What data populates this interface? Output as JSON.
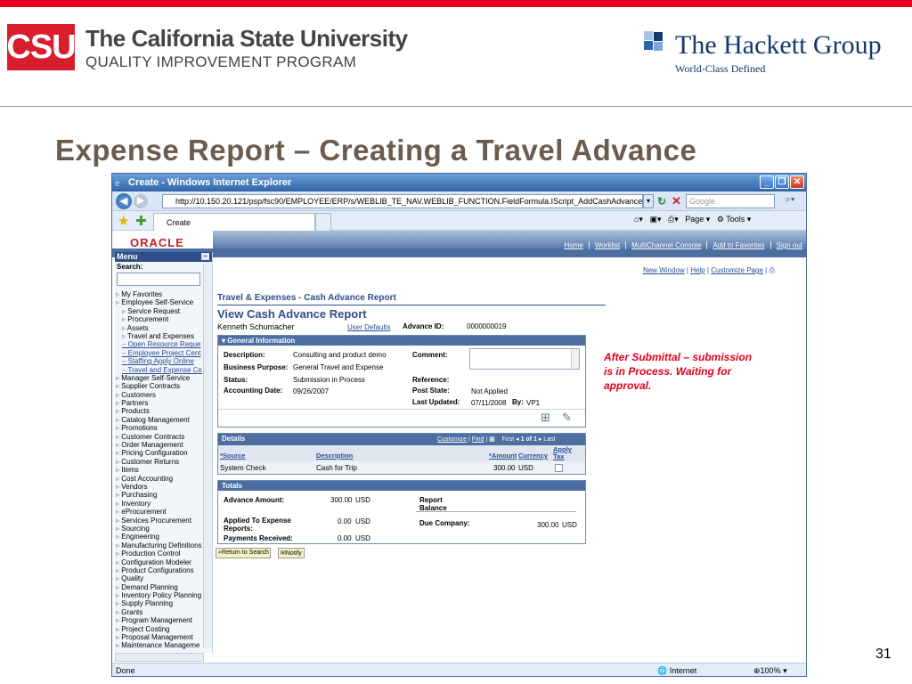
{
  "slide": {
    "csu_logo": "CSU",
    "csu_name": "The California State University",
    "csu_subtitle": "QUALITY IMPROVEMENT PROGRAM",
    "hackett_name": "The Hackett Group",
    "hackett_tagline": "World-Class Defined",
    "title": "Expense Report – Creating a Travel Advance",
    "page_number": "31",
    "annotation": "After Submittal – submission is in Process.  Waiting for approval.",
    "colors": {
      "accent_red": "#e8001c",
      "title_brown": "#6b5c4d",
      "hackett_blue": "#123a6b"
    }
  },
  "browser": {
    "window_title": "Create - Windows Internet Explorer",
    "address": "http://10.150.20.121/psp/fsc90/EMPLOYEE/ERP/s/WEBLIB_TE_NAV.WEBLIB_FUNCTION.FieldFormula.IScript_AddCashAdvance?TE.Menu.Var=ADMIN&POF",
    "search_placeholder": "Google",
    "tab_label": "Create",
    "toolbar_page": "Page",
    "toolbar_tools": "Tools",
    "status_left": "Done",
    "status_zone": "Internet",
    "status_zoom": "100%"
  },
  "peoplesoft": {
    "logo": "ORACLE",
    "top_links": [
      "Home",
      "Worklist",
      "MultiChannel Console",
      "Add to Favorites",
      "Sign out"
    ],
    "util_links": [
      "New Window",
      "Help",
      "Customize Page"
    ],
    "menu_title": "Menu",
    "menu_search_label": "Search:",
    "menu_items": [
      {
        "label": "My Favorites",
        "level": 1,
        "link": false
      },
      {
        "label": "Employee Self-Service",
        "level": 1,
        "link": false
      },
      {
        "label": "Service Request",
        "level": 2,
        "link": false
      },
      {
        "label": "Procurement",
        "level": 2,
        "link": false
      },
      {
        "label": "Assets",
        "level": 2,
        "link": false
      },
      {
        "label": "Travel and Expenses",
        "level": 2,
        "link": false
      },
      {
        "label": "Open Resource Reque",
        "level": 2,
        "link": true
      },
      {
        "label": "Employee Project Cent",
        "level": 2,
        "link": true
      },
      {
        "label": "Staffing Apply Online",
        "level": 2,
        "link": true
      },
      {
        "label": "Travel and Expense Ce",
        "level": 2,
        "link": true
      },
      {
        "label": "Manager Self-Service",
        "level": 1,
        "link": false
      },
      {
        "label": "Supplier Contracts",
        "level": 1,
        "link": false
      },
      {
        "label": "Customers",
        "level": 1,
        "link": false
      },
      {
        "label": "Partners",
        "level": 1,
        "link": false
      },
      {
        "label": "Products",
        "level": 1,
        "link": false
      },
      {
        "label": "Catalog Management",
        "level": 1,
        "link": false
      },
      {
        "label": "Promotions",
        "level": 1,
        "link": false
      },
      {
        "label": "Customer Contracts",
        "level": 1,
        "link": false
      },
      {
        "label": "Order Management",
        "level": 1,
        "link": false
      },
      {
        "label": "Pricing Configuration",
        "level": 1,
        "link": false
      },
      {
        "label": "Customer Returns",
        "level": 1,
        "link": false
      },
      {
        "label": "Items",
        "level": 1,
        "link": false
      },
      {
        "label": "Cost Accounting",
        "level": 1,
        "link": false
      },
      {
        "label": "Vendors",
        "level": 1,
        "link": false
      },
      {
        "label": "Purchasing",
        "level": 1,
        "link": false
      },
      {
        "label": "Inventory",
        "level": 1,
        "link": false
      },
      {
        "label": "eProcurement",
        "level": 1,
        "link": false
      },
      {
        "label": "Services Procurement",
        "level": 1,
        "link": false
      },
      {
        "label": "Sourcing",
        "level": 1,
        "link": false
      },
      {
        "label": "Engineering",
        "level": 1,
        "link": false
      },
      {
        "label": "Manufacturing Definitions",
        "level": 1,
        "link": false
      },
      {
        "label": "Production Control",
        "level": 1,
        "link": false
      },
      {
        "label": "Configuration Modeler",
        "level": 1,
        "link": false
      },
      {
        "label": "Product Configurations",
        "level": 1,
        "link": false
      },
      {
        "label": "Quality",
        "level": 1,
        "link": false
      },
      {
        "label": "Demand Planning",
        "level": 1,
        "link": false
      },
      {
        "label": "Inventory Policy Planning",
        "level": 1,
        "link": false
      },
      {
        "label": "Supply Planning",
        "level": 1,
        "link": false
      },
      {
        "label": "Grants",
        "level": 1,
        "link": false
      },
      {
        "label": "Program Management",
        "level": 1,
        "link": false
      },
      {
        "label": "Project Costing",
        "level": 1,
        "link": false
      },
      {
        "label": "Proposal Management",
        "level": 1,
        "link": false
      },
      {
        "label": "Maintenance Manageme",
        "level": 1,
        "link": false
      }
    ],
    "breadcrumb": "Travel & Expenses - Cash Advance Report",
    "heading": "View Cash Advance Report",
    "employee_name": "Kenneth Schumacher",
    "user_defaults": "User Defaults",
    "advance_id_label": "Advance ID:",
    "advance_id": "0000000019",
    "general": {
      "header": "General Information",
      "description_label": "Description:",
      "description": "Consulting and product demo",
      "business_purpose_label": "Business Purpose:",
      "business_purpose": "General Travel and Expense",
      "status_label": "Status:",
      "status": "Submission in Process",
      "accounting_date_label": "Accounting Date:",
      "accounting_date": "09/26/2007",
      "comment_label": "Comment:",
      "reference_label": "Reference:",
      "post_state_label": "Post State:",
      "post_state": "Not Applied",
      "last_updated_label": "Last Updated:",
      "last_updated": "07/11/2008",
      "by_label": "By:",
      "by": "VP1"
    },
    "details": {
      "header": "Details",
      "nav_customize": "Customize",
      "nav_find": "Find",
      "nav_first": "First",
      "nav_count": "1 of 1",
      "nav_last": "Last",
      "columns": [
        "*Source",
        "Description",
        "*Amount",
        "Currency",
        "Apply Tax"
      ],
      "rows": [
        {
          "source": "System Check",
          "description": "Cash for Trip",
          "amount": "300.00",
          "currency": "USD"
        }
      ]
    },
    "totals": {
      "header": "Totals",
      "advance_amount_label": "Advance Amount:",
      "advance_amount": "300.00",
      "advance_currency": "USD",
      "applied_label": "Applied To Expense Reports:",
      "applied_amount": "0.00",
      "applied_currency": "USD",
      "payments_label": "Payments Received:",
      "payments_amount": "0.00",
      "payments_currency": "USD",
      "report_balance_label": "Report Balance",
      "due_company_label": "Due Company:",
      "due_company_amount": "300.00",
      "due_company_currency": "USD"
    },
    "buttons": {
      "return": "Return to Search",
      "notify": "Notify"
    }
  }
}
